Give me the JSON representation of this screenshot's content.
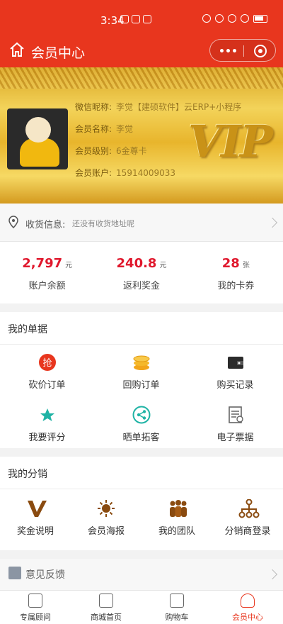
{
  "status": {
    "time": "3:34"
  },
  "nav": {
    "title": "会员中心"
  },
  "profile": {
    "nickname_label": "微信昵称:",
    "nickname": "李觉【建硕软件】云ERP+小程序",
    "name_label": "会员名称:",
    "name": "李觉",
    "level_label": "会员级别:",
    "level": "6金尊卡",
    "account_label": "会员账户:",
    "account": "15914009033",
    "vip_mark": "VIP"
  },
  "address": {
    "label": "收货信息:",
    "value": "还没有收货地址呢"
  },
  "stats": [
    {
      "value": "2,797",
      "unit": "元",
      "caption": "账户余额"
    },
    {
      "value": "240.8",
      "unit": "元",
      "caption": "返利奖金"
    },
    {
      "value": "28",
      "unit": "张",
      "caption": "我的卡券"
    }
  ],
  "orders": {
    "title": "我的单据",
    "items": [
      {
        "label": "砍价订单",
        "icon": "bargain-icon"
      },
      {
        "label": "回购订单",
        "icon": "coins-icon"
      },
      {
        "label": "购买记录",
        "icon": "wallet-icon"
      },
      {
        "label": "我要评分",
        "icon": "star-icon"
      },
      {
        "label": "晒单拓客",
        "icon": "share-icon"
      },
      {
        "label": "电子票据",
        "icon": "receipt-icon"
      }
    ]
  },
  "distribution": {
    "title": "我的分销",
    "items": [
      {
        "label": "奖金说明",
        "icon": "v-logo-icon"
      },
      {
        "label": "会员海报",
        "icon": "poster-icon"
      },
      {
        "label": "我的团队",
        "icon": "team-icon"
      },
      {
        "label": "分销商登录",
        "icon": "network-icon"
      }
    ]
  },
  "feedback": {
    "label": "意见反馈"
  },
  "tabbar": [
    {
      "label": "专属顾问",
      "icon": "advisor-icon"
    },
    {
      "label": "商城首页",
      "icon": "home-icon"
    },
    {
      "label": "购物车",
      "icon": "cart-icon"
    },
    {
      "label": "会员中心",
      "icon": "user-icon",
      "active": true
    }
  ],
  "colors": {
    "primary": "#e8361e",
    "price": "#e0182d",
    "gold": "#f3d35a"
  }
}
